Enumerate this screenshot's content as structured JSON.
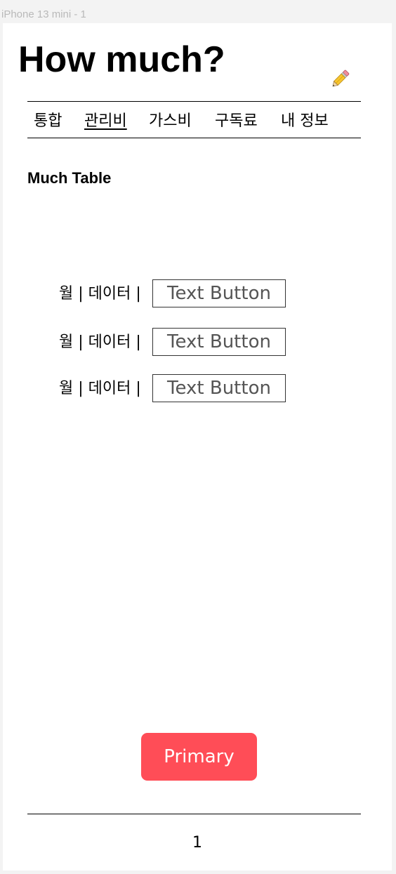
{
  "frame_label": "iPhone 13 mini - 1",
  "header": {
    "title": "How much?",
    "edit_icon": "pencil-icon"
  },
  "nav": {
    "items": [
      {
        "label": "통합",
        "active": false
      },
      {
        "label": "관리비",
        "active": true
      },
      {
        "label": "가스비",
        "active": false
      },
      {
        "label": "구독료",
        "active": false
      },
      {
        "label": "내 정보",
        "active": false
      }
    ]
  },
  "section": {
    "title": "Much Table"
  },
  "rows": [
    {
      "text": "월 | 데이터 |",
      "button_label": "Text Button"
    },
    {
      "text": "월 | 데이터 |",
      "button_label": "Text Button"
    },
    {
      "text": "월 | 데이터 |",
      "button_label": "Text Button"
    }
  ],
  "primary_button": {
    "label": "Primary"
  },
  "pagination": {
    "page": "1"
  },
  "colors": {
    "primary": "#ff4d57",
    "background": "#ffffff",
    "canvas": "#f3f3f3"
  }
}
